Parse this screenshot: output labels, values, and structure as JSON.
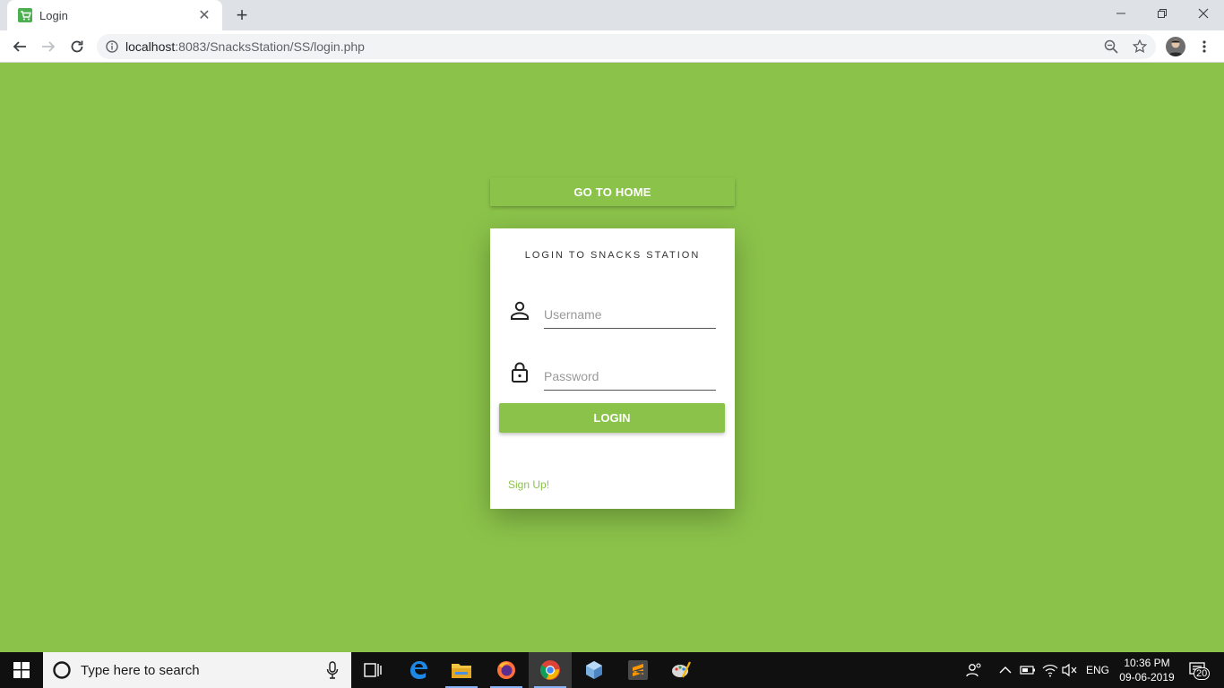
{
  "browser": {
    "tab_title": "Login",
    "url_host": "localhost",
    "url_rest": ":8083/SnacksStation/SS/login.php"
  },
  "page": {
    "home_button": "GO TO HOME",
    "card_title": "LOGIN TO SNACKS STATION",
    "username_placeholder": "Username",
    "password_placeholder": "Password",
    "login_button": "LOGIN",
    "signup_link": "Sign Up!",
    "accent_color": "#8bc34a"
  },
  "taskbar": {
    "search_placeholder": "Type here to search",
    "language": "ENG",
    "time": "10:36 PM",
    "date": "09-06-2019",
    "notification_count": "20"
  }
}
